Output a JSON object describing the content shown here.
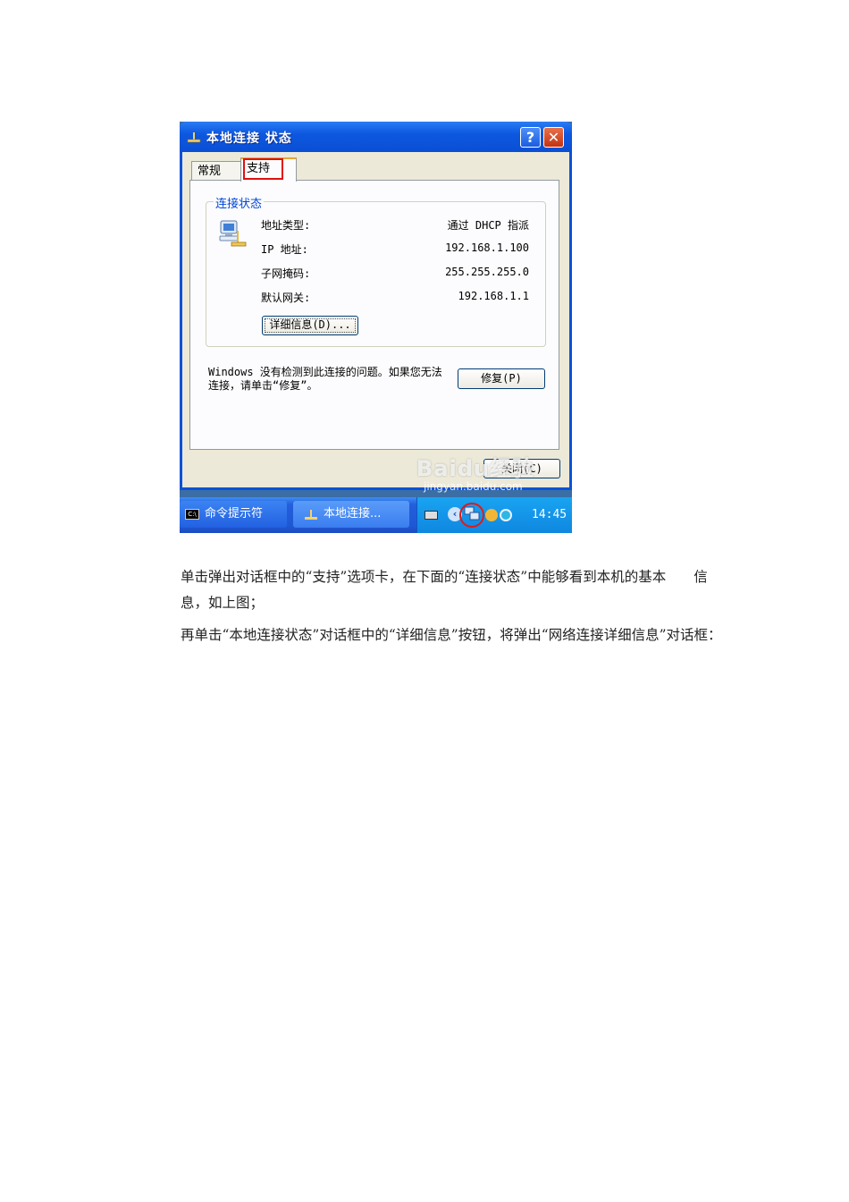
{
  "dialog": {
    "title": "本地连接 状态",
    "help_label": "?",
    "close_label": "✕",
    "tabs": [
      {
        "label": "常规"
      },
      {
        "label": "支持"
      }
    ],
    "group_title": "连接状态",
    "rows": [
      {
        "label": "地址类型:",
        "value": "通过 DHCP 指派"
      },
      {
        "label": "IP 地址:",
        "value": "192.168.1.100"
      },
      {
        "label": "子网掩码:",
        "value": "255.255.255.0"
      },
      {
        "label": "默认网关:",
        "value": "192.168.1.1"
      }
    ],
    "details_button": "详细信息(D)...",
    "repair_text": "Windows 没有检测到此连接的问题。如果您无法连接，请单击“修复”。",
    "repair_button": "修复(P)",
    "close_button": "关闭(C)"
  },
  "watermark": {
    "logo": "Baidu经验",
    "url": "jingyan.baidu.com"
  },
  "taskbar": {
    "cmd_icon_text": "C:\\",
    "items": [
      {
        "label": "命令提示符"
      },
      {
        "label": "本地连接..."
      }
    ],
    "clock": "14:45"
  },
  "paragraphs": [
    "单击弹出对话框中的“支持”选项卡，在下面的“连接状态”中能够看到本机的基本　　信息，如上图；",
    "再单击“本地连接状态”对话框中的“详细信息”按钮，将弹出“网络连接详细信息”对话框："
  ]
}
